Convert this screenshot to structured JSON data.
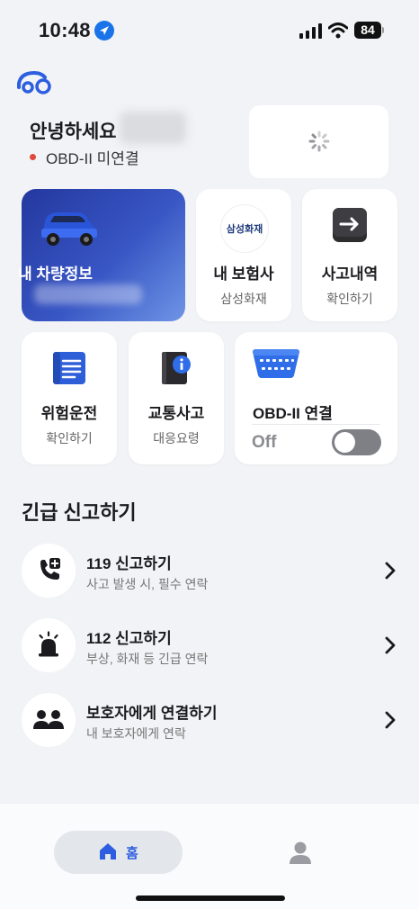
{
  "status_bar": {
    "time": "10:48",
    "battery": "84"
  },
  "header": {
    "greeting": "안녕하세요",
    "obd_status": "OBD-II 미연결"
  },
  "cards": {
    "vehicle": {
      "title": "내 차량정보"
    },
    "insurance": {
      "title": "내 보험사",
      "subtitle": "삼성화재",
      "logo_text": "삼성화재"
    },
    "accident_history": {
      "title": "사고내역",
      "subtitle": "확인하기"
    },
    "risky_driving": {
      "title": "위험운전",
      "subtitle": "확인하기"
    },
    "traffic_accident": {
      "title": "교통사고",
      "subtitle": "대응요령"
    },
    "obd": {
      "title": "OBD-II 연결",
      "toggle_label": "Off",
      "enabled": false
    }
  },
  "emergency": {
    "section_title": "긴급 신고하기",
    "items": [
      {
        "title": "119 신고하기",
        "subtitle": "사고 발생 시, 필수 연락",
        "icon": "phone-plus-icon"
      },
      {
        "title": "112 신고하기",
        "subtitle": "부상, 화재 등 긴급 연락",
        "icon": "siren-icon"
      },
      {
        "title": "보호자에게 연결하기",
        "subtitle": "내 보호자에게 연락",
        "icon": "people-icon"
      }
    ]
  },
  "tab_bar": {
    "home_label": "홈"
  },
  "colors": {
    "accent": "#2d5ee0",
    "card_gradient_start": "#24389f",
    "card_gradient_end": "#6f94e6",
    "status_red": "#e0483d"
  }
}
